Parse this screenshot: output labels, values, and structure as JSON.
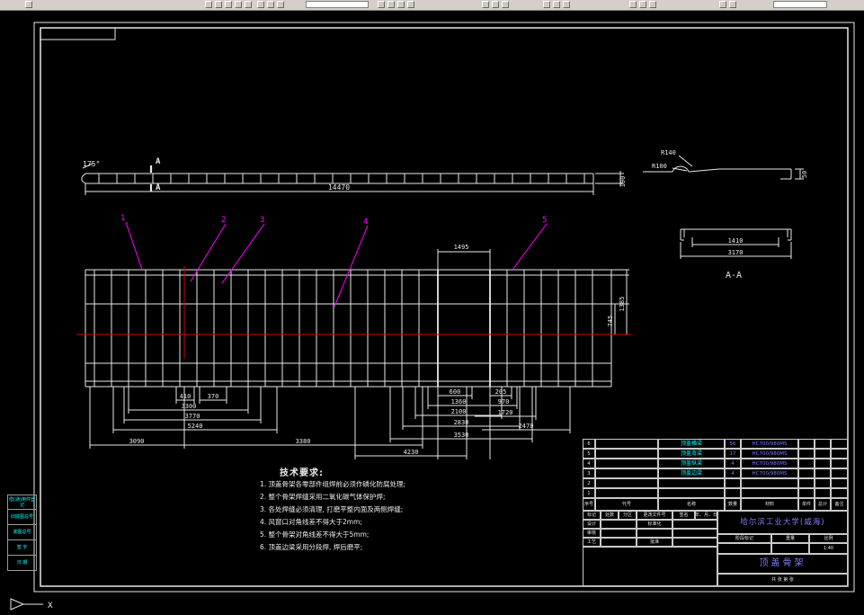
{
  "drawing": {
    "top_view": {
      "angle": "175°",
      "section_a_top": "A",
      "section_a_bottom": "A",
      "dim_length": "14470",
      "dim_height": "190"
    },
    "detail": {
      "r140": "R140",
      "r100": "R100",
      "dim50": "50"
    },
    "section_aa": {
      "dim_inner": "1410",
      "dim_outer": "3170",
      "label": "A-A"
    },
    "plan": {
      "balloon_1": "1",
      "balloon_2": "2",
      "balloon_3": "3",
      "balloon_4": "4",
      "balloon_5": "5",
      "dim_window": "1495",
      "dim_745": "745",
      "dim_1385": "1385",
      "dim_410": "410",
      "dim_370": "370",
      "dim_3300": "3300",
      "dim_3770": "3770",
      "dim_5240": "5240",
      "dim_3090": "3090",
      "dim_3380": "3380",
      "dim_600": "600",
      "dim_205": "205",
      "dim_1360": "1360",
      "dim_970": "970",
      "dim_2100": "2100",
      "dim_1720": "1720",
      "dim_2830": "2830",
      "dim_2470": "2470",
      "dim_3530": "3530",
      "dim_4230": "4230"
    }
  },
  "ucs": {
    "x_label": "X"
  },
  "tech_req": {
    "title": "技术要求:",
    "lines": [
      "1. 顶盖骨架各零部件组焊前必须作磷化防腐处理;",
      "2. 整个骨架焊缝采用二氧化碳气体保护焊;",
      "3. 各处焊缝必须清理, 打磨平整内面及两侧焊缝;",
      "4. 风窗口对角线差不得大于2mm;",
      "5. 整个骨架对角线差不得大于5mm;",
      "6. 顶盖边梁采用分段焊, 焊后磨平;"
    ]
  },
  "parts_list": {
    "headers": {
      "no": "序号",
      "code": "代号",
      "name": "名称",
      "qty": "数量",
      "material": "材料",
      "unit": "单件",
      "total": "总计",
      "note": "备注"
    },
    "rows": [
      {
        "no": "6",
        "code": "",
        "name": "顶盖横梁",
        "qty": "56",
        "material": "HC700/980MS"
      },
      {
        "no": "5",
        "code": "",
        "name": "顶盖弯梁",
        "qty": "17",
        "material": "HC700/980MS"
      },
      {
        "no": "4",
        "code": "",
        "name": "顶盖纵梁",
        "qty": "4",
        "material": "HC700/980MS"
      },
      {
        "no": "3",
        "code": "",
        "name": "顶盖边梁",
        "qty": "4",
        "material": "HC700/980MS"
      },
      {
        "no": "2",
        "code": "",
        "name": "",
        "qty": "",
        "material": ""
      },
      {
        "no": "1",
        "code": "",
        "name": "",
        "qty": "",
        "material": ""
      }
    ]
  },
  "title_block": {
    "company": "哈尔滨工业大学(威海)",
    "drawing_name": "顶盖骨架",
    "scale_value": "1:40",
    "sheet_info": "共 张 第 张",
    "labels": {
      "mark": "标记",
      "count": "处数",
      "zone": "分区",
      "change_doc": "更改文件号",
      "signature": "签名",
      "date": "年、月、日",
      "design": "设计",
      "standardization": "标准化",
      "audit": "审核",
      "process": "工艺",
      "approve": "批准",
      "stage": "阶段标记",
      "weight": "重量",
      "scale": "比例"
    }
  },
  "margin_block": {
    "rows": [
      "借(通)用件登记",
      "旧底图总号",
      "底图总号",
      "签 字",
      "日 期"
    ]
  },
  "colors": {
    "line": "#e8e8e8",
    "center": "#d40000",
    "leader": "#ff00ff",
    "cyan": "#00ffff",
    "blue": "#7a7aff"
  }
}
